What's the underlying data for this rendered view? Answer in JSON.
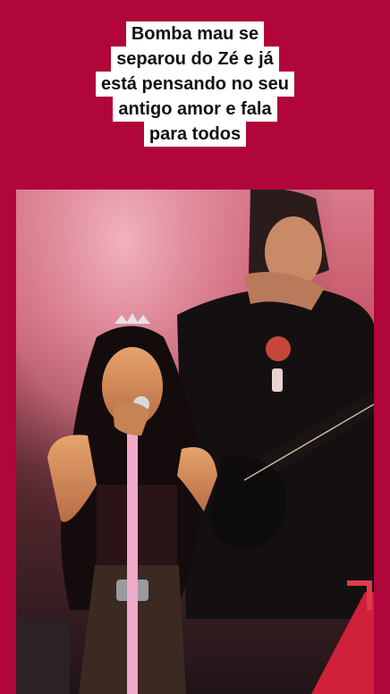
{
  "caption": {
    "lines": [
      "Bomba mau se",
      "separou do Zé e já",
      "está pensando no seu",
      "antigo amor e fala",
      "para todos"
    ]
  },
  "colors": {
    "background": "#b0063a",
    "caption_bg": "#ffffff",
    "caption_text": "#111111"
  }
}
